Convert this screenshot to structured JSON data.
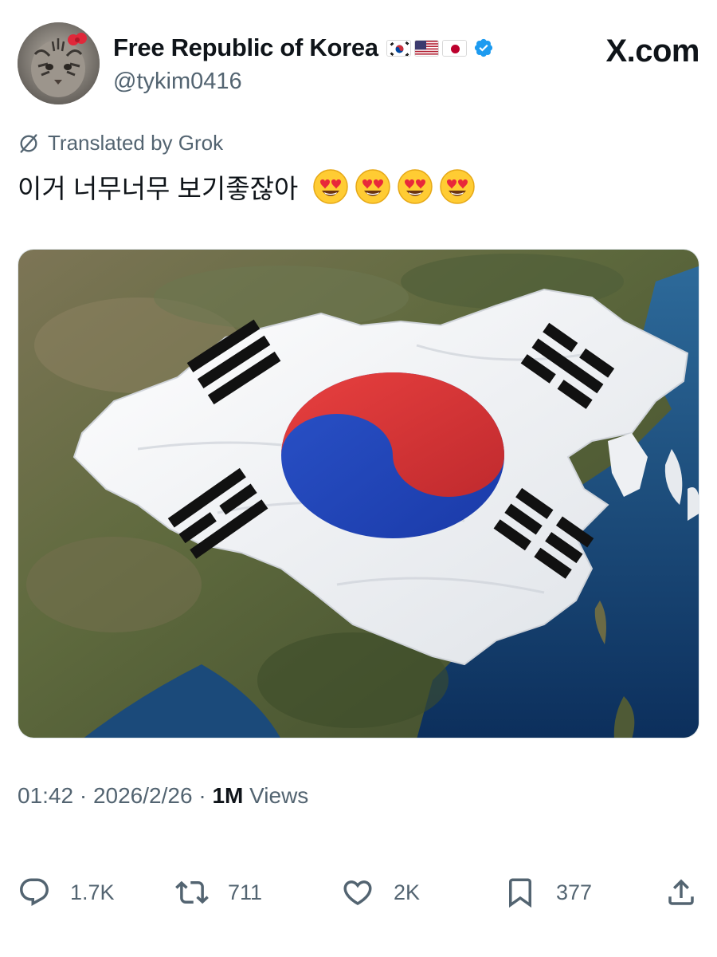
{
  "author": {
    "display_name": "Free Republic of Korea",
    "flags": [
      "south-korea-flag",
      "usa-flag",
      "japan-flag"
    ],
    "verified": true,
    "handle": "@tykim0416"
  },
  "site_logo": "X.com",
  "translation": {
    "label": "Translated by Grok"
  },
  "tweet": {
    "text": "이거 너무너무 보기좋잖아",
    "emojis": [
      "heart-eyes-emoji",
      "heart-eyes-emoji",
      "heart-eyes-emoji",
      "heart-eyes-emoji"
    ]
  },
  "media": {
    "description_icon": "korean-flag-over-china-map-image"
  },
  "meta": {
    "time": "01:42",
    "separator": "·",
    "date": "2026/2/26",
    "views_count": "1M",
    "views_label": "Views"
  },
  "actions": {
    "replies": "1.7K",
    "reposts": "711",
    "likes": "2K",
    "bookmarks": "377"
  },
  "colors": {
    "text_primary": "#0f1419",
    "text_secondary": "#536471",
    "verified_blue": "#1d9bf0",
    "taeguk_red": "#cd2e3a",
    "taeguk_blue": "#0047a0"
  }
}
